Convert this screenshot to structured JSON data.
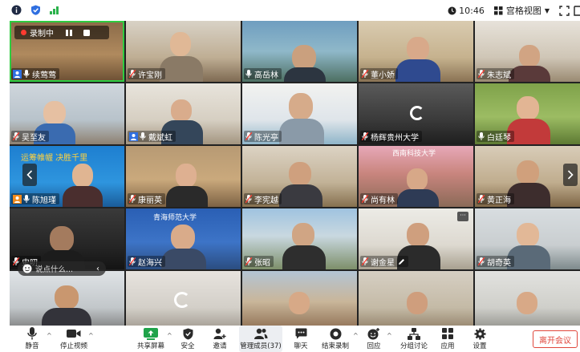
{
  "status": {
    "time": "10:46",
    "view_label": "宫格视图"
  },
  "recording": {
    "label": "录制中"
  },
  "tiles": [
    {
      "name": "续莺莺"
    },
    {
      "name": "许宝刚"
    },
    {
      "name": "高岳林"
    },
    {
      "name": "董小娇"
    },
    {
      "name": "朱志斌"
    },
    {
      "name": "吴至友"
    },
    {
      "name": "戴斌虹"
    },
    {
      "name": "陈光亭"
    },
    {
      "name": "杨辉贵州大学"
    },
    {
      "name": "白廷琴"
    },
    {
      "name": "陈旭瑾"
    },
    {
      "name": "康丽英"
    },
    {
      "name": "李宪越"
    },
    {
      "name": "尚有林"
    },
    {
      "name": "黄正海"
    },
    {
      "name": "史叨"
    },
    {
      "name": "赵海兴"
    },
    {
      "name": "张昭"
    },
    {
      "name": "谢金星"
    },
    {
      "name": "胡奇英"
    }
  ],
  "banner_text": "运筹帷幄 决胜千里",
  "university_sign": "青海师范大学",
  "building_sign": "西南科技大学",
  "chat_hint": "说点什么...",
  "toolbar": {
    "mute": "静音",
    "stop_video": "停止视频",
    "share": "共享屏幕",
    "security": "安全",
    "invite": "邀请",
    "participants": "管理成员(37)",
    "chat": "聊天",
    "end_record": "结束录制",
    "reaction": "回应",
    "breakout": "分组讨论",
    "apps": "应用",
    "settings": "设置",
    "leave": "离开会议"
  }
}
